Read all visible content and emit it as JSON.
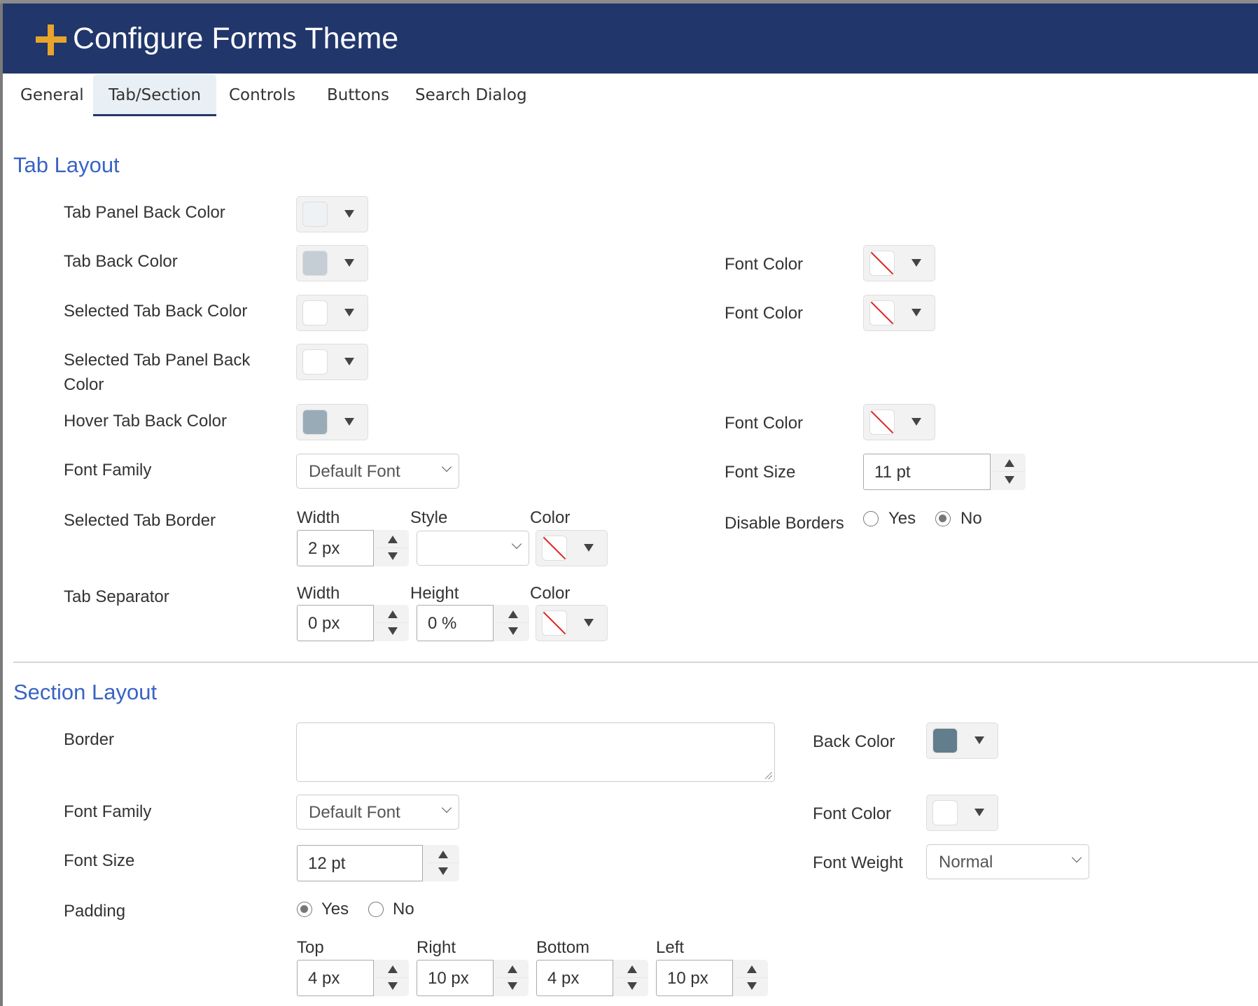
{
  "header": {
    "title": "Configure Forms Theme",
    "icon": "plus-icon",
    "accent": "#e8a52b",
    "background": "#21366b"
  },
  "tabs": [
    {
      "label": "General",
      "active": false
    },
    {
      "label": "Tab/Section",
      "active": true
    },
    {
      "label": "Controls",
      "active": false
    },
    {
      "label": "Buttons",
      "active": false
    },
    {
      "label": "Search Dialog",
      "active": false
    }
  ],
  "tab_layout": {
    "heading": "Tab Layout",
    "tab_panel_back_color": {
      "label": "Tab Panel Back Color",
      "color": "#eff2f5"
    },
    "tab_back_color": {
      "label": "Tab Back Color",
      "color": "#c5ced5",
      "font_color_label": "Font Color",
      "font_color": "none"
    },
    "selected_tab_back_color": {
      "label": "Selected Tab Back Color",
      "color": "#ffffff",
      "font_color_label": "Font Color",
      "font_color": "none"
    },
    "selected_tab_panel_back_color": {
      "label_line1": "Selected Tab Panel Back",
      "label_line2": "Color",
      "color": "#ffffff"
    },
    "hover_tab_back_color": {
      "label": "Hover Tab Back Color",
      "color": "#9aabb8",
      "font_color_label": "Font Color",
      "font_color": "none"
    },
    "font_family": {
      "label": "Font Family",
      "value": "Default Font"
    },
    "font_size": {
      "label": "Font Size",
      "value": "11 pt"
    },
    "selected_tab_border": {
      "label": "Selected Tab Border",
      "width_label": "Width",
      "width": "2 px",
      "style_label": "Style",
      "style": "",
      "color_label": "Color",
      "color": "none"
    },
    "disable_borders": {
      "label": "Disable Borders",
      "options": [
        "Yes",
        "No"
      ],
      "selected": "No"
    },
    "tab_separator": {
      "label": "Tab Separator",
      "width_label": "Width",
      "width": "0 px",
      "height_label": "Height",
      "height": "0 %",
      "color_label": "Color",
      "color": "none"
    }
  },
  "section_layout": {
    "heading": "Section Layout",
    "border": {
      "label": "Border",
      "value": ""
    },
    "back_color": {
      "label": "Back Color",
      "color": "#627d8b"
    },
    "font_family": {
      "label": "Font Family",
      "value": "Default Font"
    },
    "font_color": {
      "label": "Font Color",
      "color": "#ffffff"
    },
    "font_size": {
      "label": "Font Size",
      "value": "12 pt"
    },
    "font_weight": {
      "label": "Font Weight",
      "value": "Normal"
    },
    "padding": {
      "label": "Padding",
      "options": [
        "Yes",
        "No"
      ],
      "selected": "Yes",
      "top_label": "Top",
      "top": "4 px",
      "right_label": "Right",
      "right": "10 px",
      "bottom_label": "Bottom",
      "bottom": "4 px",
      "left_label": "Left",
      "left": "10 px"
    }
  }
}
